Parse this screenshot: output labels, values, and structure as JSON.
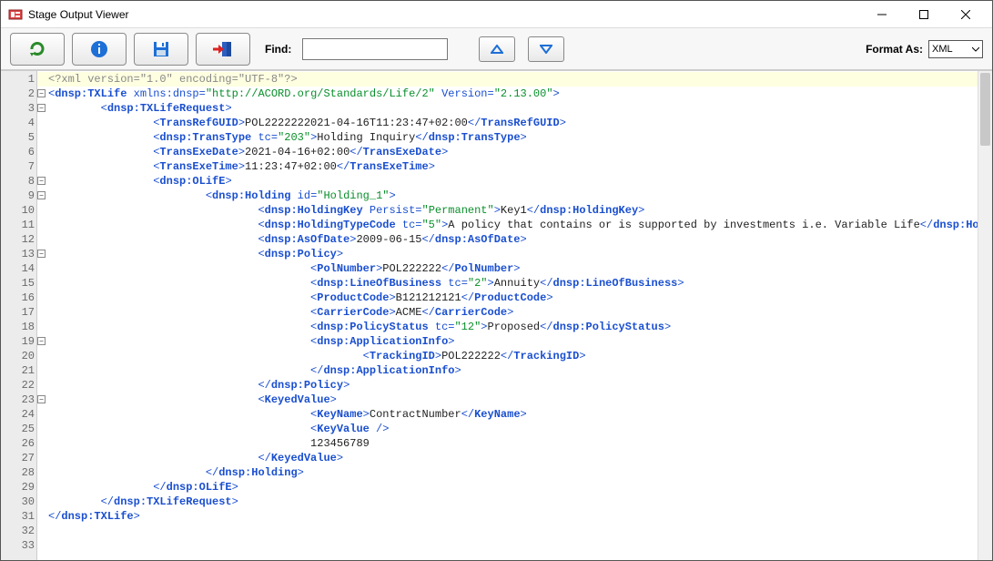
{
  "window": {
    "title": "Stage Output Viewer"
  },
  "toolbar": {
    "find_label": "Find:",
    "find_value": "",
    "format_as_label": "Format As:",
    "format_value": "XML"
  },
  "gutter": {
    "lines": 33,
    "fold_markers": [
      2,
      3,
      8,
      9,
      13,
      19,
      23
    ]
  },
  "code_lines": [
    {
      "indent": 0,
      "type": "pi",
      "raw": "<?xml version=\"1.0\" encoding=\"UTF-8\"?>"
    },
    {
      "indent": 0,
      "type": "open",
      "tag": "dnsp:TXLife",
      "attrs": [
        {
          "n": "xmlns:dnsp",
          "v": "http://ACORD.org/Standards/Life/2"
        },
        {
          "n": "Version",
          "v": "2.13.00"
        }
      ]
    },
    {
      "indent": 1,
      "type": "open",
      "tag": "dnsp:TXLifeRequest"
    },
    {
      "indent": 2,
      "type": "leaf",
      "tag": "TransRefGUID",
      "text": "POL2222222021-04-16T11:23:47+02:00"
    },
    {
      "indent": 2,
      "type": "leaf",
      "tag": "dnsp:TransType",
      "attrs": [
        {
          "n": "tc",
          "v": "203"
        }
      ],
      "text": "Holding Inquiry"
    },
    {
      "indent": 2,
      "type": "leaf",
      "tag": "TransExeDate",
      "text": "2021-04-16+02:00"
    },
    {
      "indent": 2,
      "type": "leaf",
      "tag": "TransExeTime",
      "text": "11:23:47+02:00"
    },
    {
      "indent": 2,
      "type": "open",
      "tag": "dnsp:OLifE"
    },
    {
      "indent": 3,
      "type": "open",
      "tag": "dnsp:Holding",
      "attrs": [
        {
          "n": "id",
          "v": "Holding_1"
        }
      ]
    },
    {
      "indent": 4,
      "type": "leaf",
      "tag": "dnsp:HoldingKey",
      "attrs": [
        {
          "n": "Persist",
          "v": "Permanent"
        }
      ],
      "text": "Key1"
    },
    {
      "indent": 4,
      "type": "leaf",
      "tag": "dnsp:HoldingTypeCode",
      "attrs": [
        {
          "n": "tc",
          "v": "5"
        }
      ],
      "text": "A policy that contains or is supported by investments i.e. Variable Life"
    },
    {
      "indent": 4,
      "type": "leaf",
      "tag": "dnsp:AsOfDate",
      "text": "2009-06-15"
    },
    {
      "indent": 4,
      "type": "open",
      "tag": "dnsp:Policy"
    },
    {
      "indent": 5,
      "type": "leaf",
      "tag": "PolNumber",
      "text": "POL222222"
    },
    {
      "indent": 5,
      "type": "leaf",
      "tag": "dnsp:LineOfBusiness",
      "attrs": [
        {
          "n": "tc",
          "v": "2"
        }
      ],
      "text": "Annuity"
    },
    {
      "indent": 5,
      "type": "leaf",
      "tag": "ProductCode",
      "text": "B121212121"
    },
    {
      "indent": 5,
      "type": "leaf",
      "tag": "CarrierCode",
      "text": "ACME"
    },
    {
      "indent": 5,
      "type": "leaf",
      "tag": "dnsp:PolicyStatus",
      "attrs": [
        {
          "n": "tc",
          "v": "12"
        }
      ],
      "text": "Proposed"
    },
    {
      "indent": 5,
      "type": "open",
      "tag": "dnsp:ApplicationInfo"
    },
    {
      "indent": 6,
      "type": "leaf",
      "tag": "TrackingID",
      "text": "POL222222"
    },
    {
      "indent": 5,
      "type": "close",
      "tag": "dnsp:ApplicationInfo"
    },
    {
      "indent": 4,
      "type": "close",
      "tag": "dnsp:Policy"
    },
    {
      "indent": 4,
      "type": "open",
      "tag": "KeyedValue"
    },
    {
      "indent": 5,
      "type": "leaf",
      "tag": "KeyName",
      "text": "ContractNumber"
    },
    {
      "indent": 5,
      "type": "empty",
      "tag": "KeyValue"
    },
    {
      "indent": 5,
      "type": "text",
      "text": "123456789"
    },
    {
      "indent": 4,
      "type": "close",
      "tag": "KeyedValue"
    },
    {
      "indent": 3,
      "type": "close",
      "tag": "dnsp:Holding"
    },
    {
      "indent": 2,
      "type": "close",
      "tag": "dnsp:OLifE"
    },
    {
      "indent": 1,
      "type": "close",
      "tag": "dnsp:TXLifeRequest"
    },
    {
      "indent": 0,
      "type": "close",
      "tag": "dnsp:TXLife"
    },
    {
      "indent": 0,
      "type": "blank"
    },
    {
      "indent": 0,
      "type": "blank"
    }
  ]
}
